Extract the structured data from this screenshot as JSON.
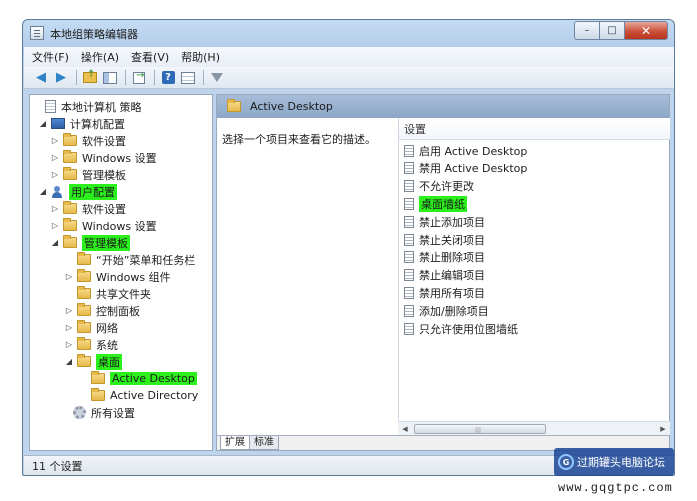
{
  "window": {
    "title": "本地组策略编辑器"
  },
  "title_buttons": {
    "minimize": "–",
    "maximize": "□",
    "close": "✕"
  },
  "menu": [
    {
      "label": "文件(F)"
    },
    {
      "label": "操作(A)"
    },
    {
      "label": "查看(V)"
    },
    {
      "label": "帮助(H)"
    }
  ],
  "toolbar_icons": [
    "back-arrow-icon",
    "forward-arrow-icon",
    "up-folder-icon",
    "show-pane-icon",
    "export-list-icon",
    "help-icon",
    "view-icon",
    "filter-icon"
  ],
  "tree": [
    {
      "label": "本地计算机 策略",
      "arrow": "",
      "icon": "document",
      "highlight": false
    },
    {
      "label": "计算机配置",
      "arrow": "◢",
      "icon": "computer",
      "highlight": false
    },
    {
      "label": "软件设置",
      "arrow": "▷",
      "icon": "folder",
      "highlight": false
    },
    {
      "label": "Windows 设置",
      "arrow": "▷",
      "icon": "folder",
      "highlight": false
    },
    {
      "label": "管理模板",
      "arrow": "▷",
      "icon": "folder",
      "highlight": false
    },
    {
      "label": "用户配置",
      "arrow": "◢",
      "icon": "user",
      "highlight": true
    },
    {
      "label": "软件设置",
      "arrow": "▷",
      "icon": "folder",
      "highlight": false
    },
    {
      "label": "Windows 设置",
      "arrow": "▷",
      "icon": "folder",
      "highlight": false
    },
    {
      "label": "管理模板",
      "arrow": "◢",
      "icon": "folder",
      "highlight": true
    },
    {
      "label": "“开始”菜单和任务栏",
      "arrow": "",
      "icon": "folder",
      "highlight": false
    },
    {
      "label": "Windows 组件",
      "arrow": "▷",
      "icon": "folder",
      "highlight": false
    },
    {
      "label": "共享文件夹",
      "arrow": "",
      "icon": "folder",
      "highlight": false
    },
    {
      "label": "控制面板",
      "arrow": "▷",
      "icon": "folder",
      "highlight": false
    },
    {
      "label": "网络",
      "arrow": "▷",
      "icon": "folder",
      "highlight": false
    },
    {
      "label": "系统",
      "arrow": "▷",
      "icon": "folder",
      "highlight": false
    },
    {
      "label": "桌面",
      "arrow": "◢",
      "icon": "folder",
      "highlight": true
    },
    {
      "label": "Active Desktop",
      "arrow": "",
      "icon": "folder",
      "highlight": true
    },
    {
      "label": "Active Directory",
      "arrow": "",
      "icon": "folder",
      "highlight": false
    },
    {
      "label": "所有设置",
      "arrow": "",
      "icon": "gear",
      "highlight": false
    }
  ],
  "right_pane": {
    "header": "Active Desktop",
    "description": "选择一个项目来查看它的描述。",
    "column_header": "设置",
    "settings": [
      {
        "label": "启用 Active Desktop",
        "highlight": false
      },
      {
        "label": "禁用 Active Desktop",
        "highlight": false
      },
      {
        "label": "不允许更改",
        "highlight": false
      },
      {
        "label": "桌面墙纸",
        "highlight": true
      },
      {
        "label": "禁止添加项目",
        "highlight": false
      },
      {
        "label": "禁止关闭项目",
        "highlight": false
      },
      {
        "label": "禁止删除项目",
        "highlight": false
      },
      {
        "label": "禁止编辑项目",
        "highlight": false
      },
      {
        "label": "禁用所有项目",
        "highlight": false
      },
      {
        "label": "添加/删除项目",
        "highlight": false
      },
      {
        "label": "只允许使用位图墙纸",
        "highlight": false
      }
    ],
    "tabs": [
      {
        "label": "扩展",
        "active": true
      },
      {
        "label": "标准",
        "active": false
      }
    ]
  },
  "status": {
    "text": "11 个设置"
  },
  "watermark": {
    "text": "过期罐头电脑论坛",
    "url": "www.gqgtpc.com"
  },
  "colors": {
    "highlight": "#2bf01b",
    "header_bar": "#9fb6d3",
    "window_frame": "#c4dbf2"
  }
}
